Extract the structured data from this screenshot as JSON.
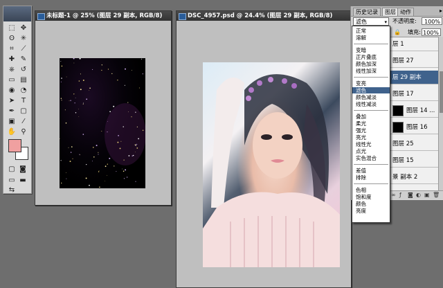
{
  "toolbox": {
    "tools": [
      {
        "name": "marquee-tool",
        "glyph": "⬚"
      },
      {
        "name": "move-tool",
        "glyph": "✥"
      },
      {
        "name": "lasso-tool",
        "glyph": "ʘ"
      },
      {
        "name": "magic-wand-tool",
        "glyph": "✳"
      },
      {
        "name": "crop-tool",
        "glyph": "⌗"
      },
      {
        "name": "slice-tool",
        "glyph": "⟋"
      },
      {
        "name": "healing-brush-tool",
        "glyph": "✚"
      },
      {
        "name": "brush-tool",
        "glyph": "✎"
      },
      {
        "name": "clone-stamp-tool",
        "glyph": "⎈"
      },
      {
        "name": "history-brush-tool",
        "glyph": "↺"
      },
      {
        "name": "eraser-tool",
        "glyph": "▭"
      },
      {
        "name": "gradient-tool",
        "glyph": "▤"
      },
      {
        "name": "blur-tool",
        "glyph": "◉"
      },
      {
        "name": "dodge-tool",
        "glyph": "◔"
      },
      {
        "name": "path-selection-tool",
        "glyph": "➤"
      },
      {
        "name": "type-tool",
        "glyph": "T"
      },
      {
        "name": "pen-tool",
        "glyph": "✒"
      },
      {
        "name": "shape-tool",
        "glyph": "▢"
      },
      {
        "name": "notes-tool",
        "glyph": "▣"
      },
      {
        "name": "eyedropper-tool",
        "glyph": "⁄"
      },
      {
        "name": "hand-tool",
        "glyph": "✋"
      },
      {
        "name": "zoom-tool",
        "glyph": "⚲"
      }
    ],
    "foreground_color": "#f0a0a0",
    "background_color": "#ffffff"
  },
  "doc1": {
    "title": "未标题-1 @ 25% (图层 29 副本, RGB/8)"
  },
  "doc2": {
    "title": "DSC_4957.psd @ 24.4% (图层 29 副本, RGB/8)"
  },
  "panels": {
    "tabs": [
      "历史记录",
      "图层",
      "动作"
    ],
    "blend_mode": "滤色",
    "opacity_label": "不透明度:",
    "opacity_value": "100%",
    "fill_label": "填充:",
    "fill_value": "100%",
    "layers": [
      {
        "name": "层 1",
        "selected": false,
        "thumb": false
      },
      {
        "name": "图层 27",
        "selected": false,
        "thumb": false
      },
      {
        "name": "层 29 副本",
        "selected": true,
        "thumb": false
      },
      {
        "name": "图层 17",
        "selected": false,
        "thumb": false
      },
      {
        "name": "图层 14 ...",
        "selected": false,
        "thumb": true
      },
      {
        "name": "图层 16",
        "selected": false,
        "thumb": true
      },
      {
        "name": "图层 25",
        "selected": false,
        "thumb": false
      },
      {
        "name": "图层 15",
        "selected": false,
        "thumb": false
      },
      {
        "name": "景 副本 2",
        "selected": false,
        "thumb": false
      }
    ]
  },
  "blend_menu": {
    "groups": [
      [
        "正常",
        "溶解"
      ],
      [
        "变暗",
        "正片叠底",
        "颜色加深",
        "线性加深"
      ],
      [
        "变亮",
        "滤色",
        "颜色减淡",
        "线性减淡"
      ],
      [
        "叠加",
        "柔光",
        "强光",
        "亮光",
        "线性光",
        "点光",
        "实色混合"
      ],
      [
        "差值",
        "排除"
      ],
      [
        "色相",
        "饱和度",
        "颜色",
        "亮度"
      ]
    ],
    "selected": "滤色"
  }
}
